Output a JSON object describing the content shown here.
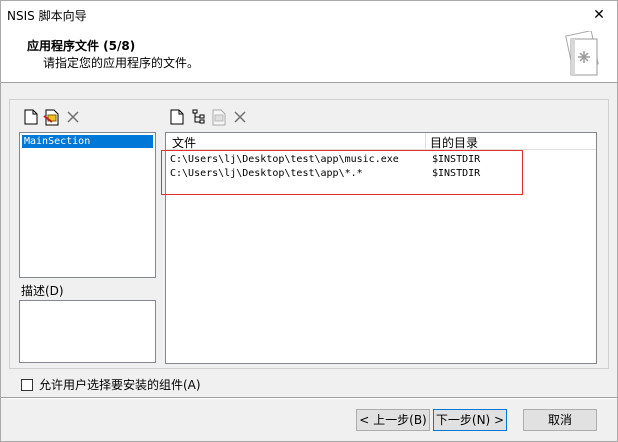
{
  "window": {
    "title": "NSIS 脚本向导",
    "close_glyph": "✕"
  },
  "header": {
    "title": "应用程序文件 (5/8)",
    "subtitle": "请指定您的应用程序的文件。"
  },
  "sections": {
    "items": [
      "MainSection"
    ]
  },
  "description": {
    "label": "描述(D)"
  },
  "files": {
    "columns": [
      "文件",
      "目的目录"
    ],
    "rows": [
      {
        "file": "C:\\Users\\lj\\Desktop\\test\\app\\music.exe",
        "dest": "$INSTDIR"
      },
      {
        "file": "C:\\Users\\lj\\Desktop\\test\\app\\*.*",
        "dest": "$INSTDIR"
      }
    ]
  },
  "checkbox": {
    "label": "允许用户选择要安装的组件(A)",
    "checked": false
  },
  "buttons": {
    "back": "< 上一步(B)",
    "next": "下一步(N) >",
    "cancel": "取消"
  },
  "colors": {
    "selection": "#0078d7",
    "highlight_border": "#e03030"
  }
}
